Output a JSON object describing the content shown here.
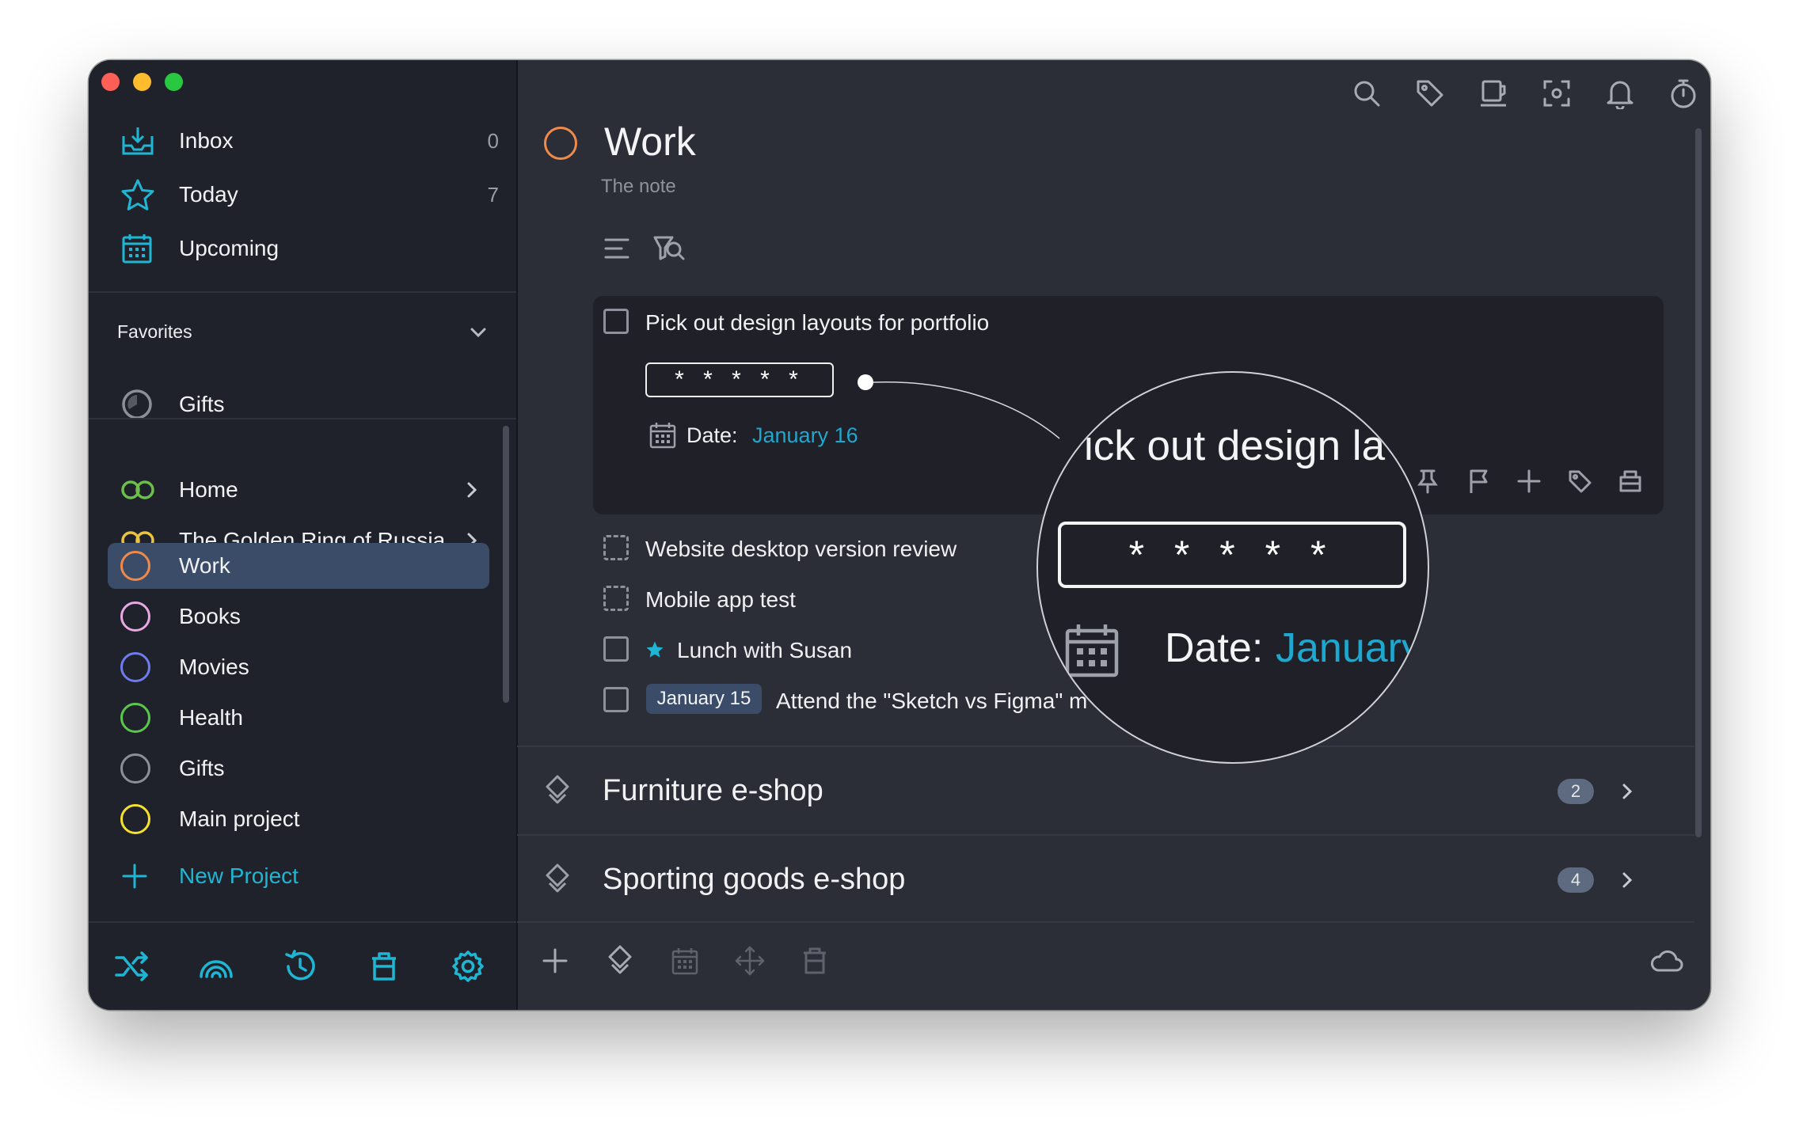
{
  "sidebar": {
    "nav": [
      {
        "label": "Inbox",
        "count": "0",
        "icon": "inbox-icon"
      },
      {
        "label": "Today",
        "count": "7",
        "icon": "star-icon"
      },
      {
        "label": "Upcoming",
        "count": "",
        "icon": "calendar-icon"
      }
    ],
    "favorites_title": "Favorites",
    "favorites": [
      {
        "label": "Gifts",
        "icon": "circle-progress-icon"
      }
    ],
    "projects": [
      {
        "label": "Home",
        "color": "#6cc04a",
        "icon": "area-rings-icon",
        "expandable": true
      },
      {
        "label": "The Golden Ring of Russia",
        "color": "#e8c440",
        "icon": "area-rings-icon",
        "expandable": true
      },
      {
        "label": "Work",
        "color": "#f08a4b",
        "selected": true
      },
      {
        "label": "Books",
        "color": "#e9a9e4"
      },
      {
        "label": "Movies",
        "color": "#6e7cf0"
      },
      {
        "label": "Health",
        "color": "#59c84a"
      },
      {
        "label": "Gifts",
        "color": "#8c8f98"
      },
      {
        "label": "Main project",
        "color": "#f4e12c"
      }
    ],
    "new_project_label": "New Project",
    "bottom_icons": [
      "shuffle-icon",
      "rainbow-icon",
      "history-icon",
      "trash-icon",
      "settings-gear-icon"
    ]
  },
  "toolbar": {
    "icons": [
      "search-icon",
      "tag-icon",
      "review-icon",
      "focus-icon",
      "bell-icon",
      "timer-icon",
      "contrast-icon",
      "windows-icon"
    ]
  },
  "main": {
    "title": "Work",
    "note": "The note",
    "tasks": [
      {
        "label": "Pick out design layouts for portfolio",
        "open": true
      },
      {
        "label": "Website desktop version review",
        "dashed": true
      },
      {
        "label": "Mobile app test",
        "dashed": true
      },
      {
        "label": "Lunch with Susan",
        "starred": true
      },
      {
        "label": "Attend the \"Sketch vs Figma\" m",
        "date_tag": "January 15"
      }
    ],
    "open_task": {
      "stars": "* * * * *",
      "date_label": "Date:",
      "date_value": "January 16"
    },
    "subprojects": [
      {
        "label": "Furniture e-shop",
        "count": "2"
      },
      {
        "label": "Sporting goods e-shop",
        "count": "4"
      }
    ]
  },
  "magnifier": {
    "text": "ick out design la",
    "stars": "* * * * *",
    "date_label": "Date:",
    "date_value": "January"
  },
  "colors": {
    "accent": "#1fb6d4",
    "date_blue": "#1fa8cf",
    "selected": "#3a4c68",
    "work_orange": "#f08a4b"
  }
}
